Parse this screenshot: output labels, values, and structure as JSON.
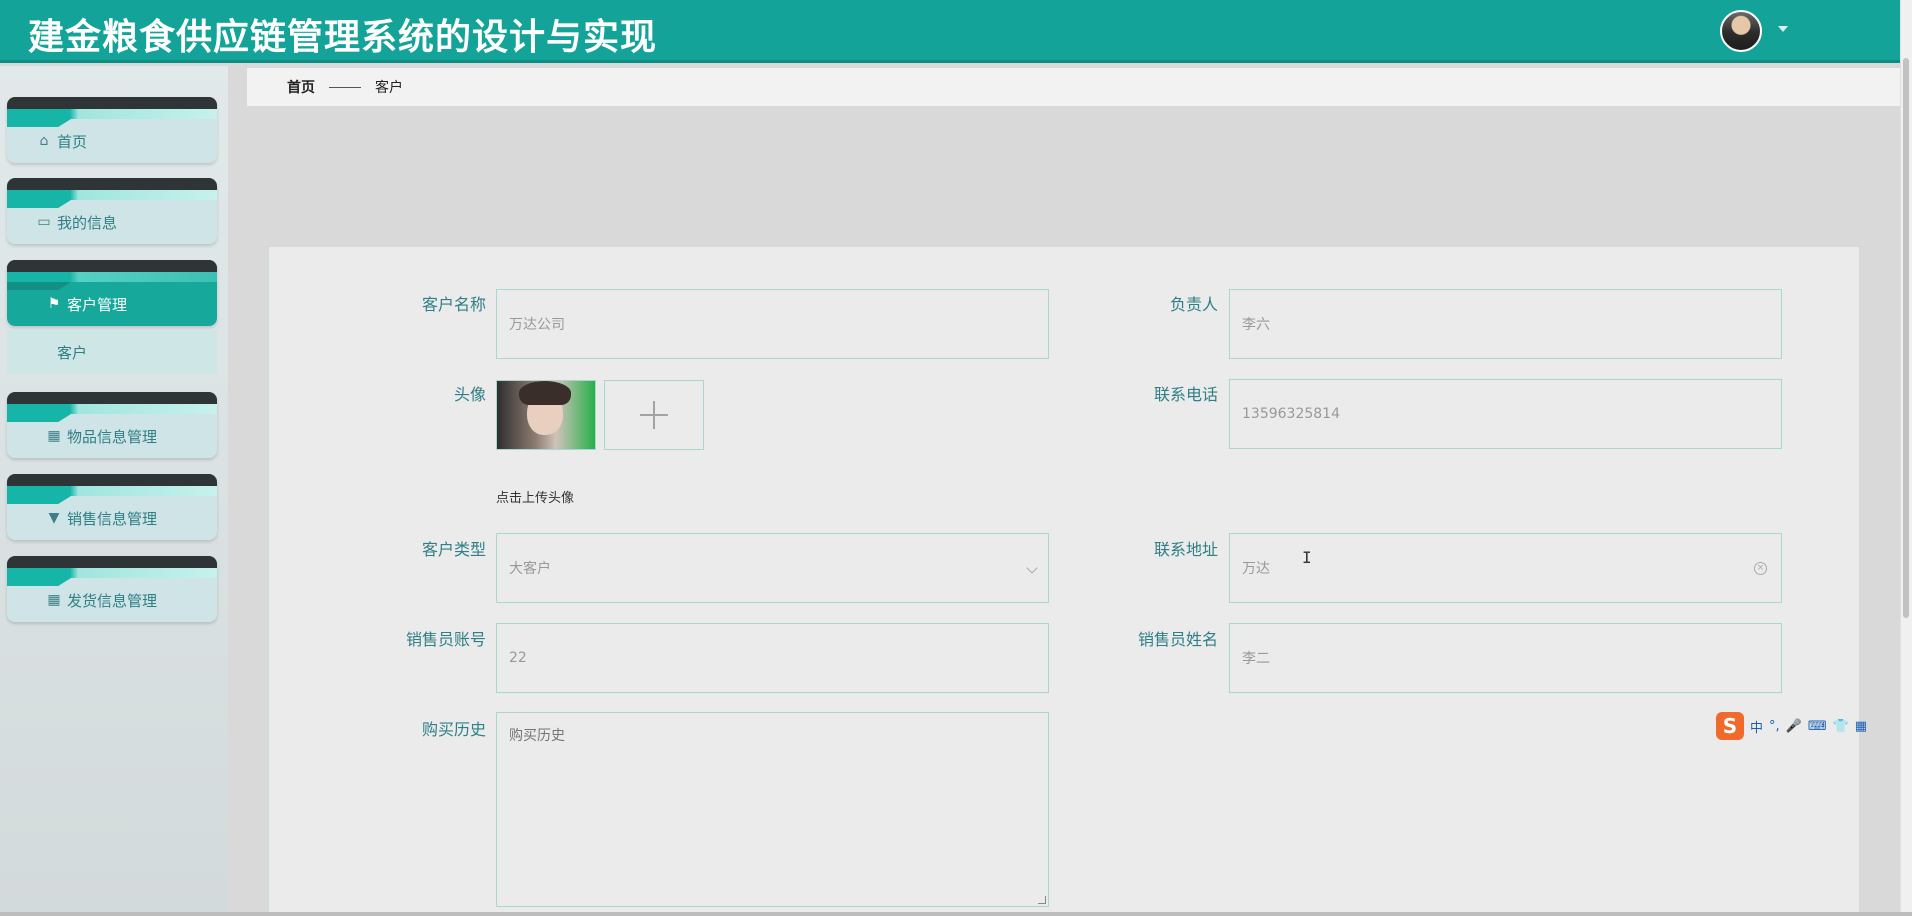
{
  "header": {
    "title": "建金粮食供应链管理系统的设计与实现"
  },
  "sidebar": {
    "items": [
      {
        "label": "首页",
        "icon": "home-icon"
      },
      {
        "label": "我的信息",
        "icon": "card-icon"
      },
      {
        "label": "客户管理",
        "icon": "flag-icon",
        "active": true
      },
      {
        "label": "物品信息管理",
        "icon": "grid-icon"
      },
      {
        "label": "销售信息管理",
        "icon": "cup-icon"
      },
      {
        "label": "发货信息管理",
        "icon": "grid-icon"
      }
    ],
    "sub_item": "客户"
  },
  "breadcrumb": {
    "home": "首页",
    "current": "客户"
  },
  "form": {
    "customer_name": {
      "label": "客户名称",
      "value": "万达公司"
    },
    "manager": {
      "label": "负责人",
      "value": "李六"
    },
    "avatar": {
      "label": "头像",
      "hint": "点击上传头像"
    },
    "phone": {
      "label": "联系电话",
      "value": "13596325814"
    },
    "customer_type": {
      "label": "客户类型",
      "value": "大客户"
    },
    "address": {
      "label": "联系地址",
      "value": "万达"
    },
    "sales_account": {
      "label": "销售员账号",
      "value": "22"
    },
    "sales_name": {
      "label": "销售员姓名",
      "value": "李二"
    },
    "purchase_history": {
      "label": "购买历史",
      "placeholder": "购买历史"
    }
  },
  "ime": {
    "logo": "S",
    "lang": "中",
    "punct": "°,"
  },
  "colors": {
    "header": "#14a399",
    "accent": "#17a89c",
    "label": "#2f7f86",
    "border": "#a8d7d2"
  }
}
